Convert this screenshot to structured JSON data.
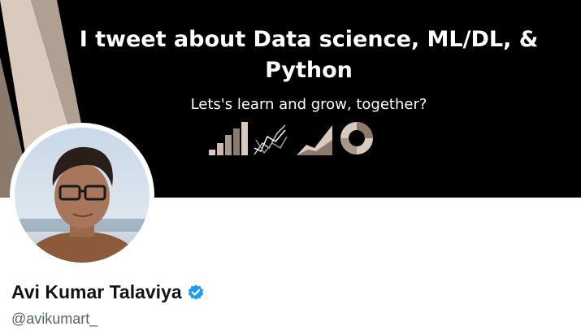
{
  "banner": {
    "title": "I tweet about Data science, ML/DL, & Python",
    "subtitle": "Lets's learn and grow, together?",
    "icons": [
      "bar-chart-icon",
      "line-chart-icon",
      "area-chart-icon",
      "donut-chart-icon"
    ],
    "colors": {
      "background": "#000000",
      "accent_light": "#d9cabd",
      "accent_dark": "#8b7a6b"
    }
  },
  "profile": {
    "display_name": "Avi Kumar Talaviya",
    "handle": "@avikumart_",
    "verified_icon": "verified-badge-icon",
    "colors": {
      "verified": "#1d9bf0",
      "name": "#0f1419",
      "handle": "#536471"
    }
  }
}
